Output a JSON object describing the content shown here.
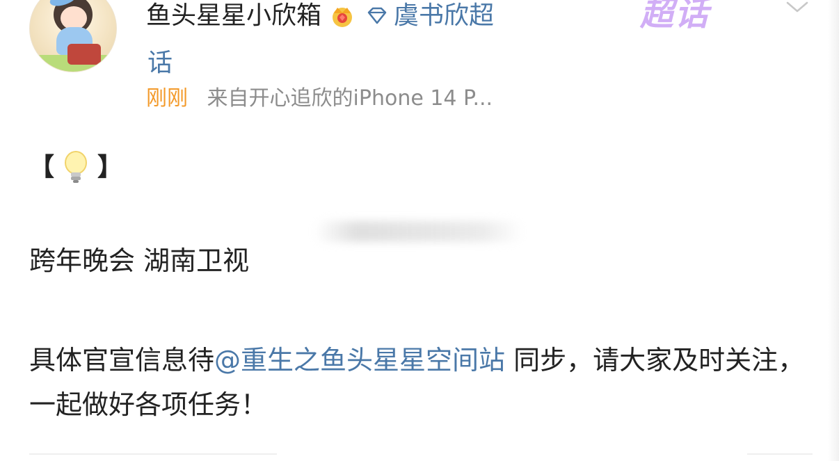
{
  "author": {
    "name": "鱼头星星小欣箱",
    "topic_part1": "虞书欣超",
    "topic_part2": "话",
    "avatar": "avatar"
  },
  "icons": {
    "crown_badge": "crown-icon",
    "diamond": "gem-icon",
    "chevron": "chevron-down-icon",
    "bulb": "bulb-icon"
  },
  "supertopic_logo": "超话",
  "meta": {
    "time": "刚刚",
    "source": "来自开心追欣的iPhone 14 P..."
  },
  "body": {
    "bracket_open": "【",
    "bracket_close": "】",
    "event": "跨年晚会 湖南卫视",
    "para_before": "具体官宣信息待",
    "mention": "@重生之鱼头星星空间站",
    "para_after": " 同步，请大家及时关注，一起做好各项任务！"
  },
  "colors": {
    "link": "#4a78a8",
    "time": "#f39a2a",
    "meta_gray": "#8c8c8c",
    "logo_purple": "#c9a0f5"
  }
}
